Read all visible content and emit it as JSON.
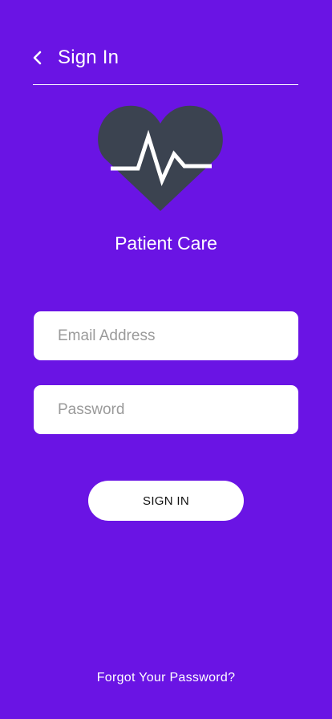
{
  "header": {
    "back_icon": "chevron-left-icon",
    "title": "Sign In"
  },
  "logo": {
    "icon": "heart-pulse-icon",
    "heart_color": "#3b4350",
    "pulse_color": "#ffffff"
  },
  "app": {
    "name": "Patient Care"
  },
  "form": {
    "email_placeholder": "Email Address",
    "password_placeholder": "Password",
    "submit_label": "SIGN IN"
  },
  "footer": {
    "forgot_label": "Forgot Your Password?"
  },
  "colors": {
    "background": "#6a14e4",
    "surface": "#ffffff",
    "text_on_background": "#ffffff",
    "button_text": "#111111",
    "placeholder": "#9a9a9a"
  }
}
